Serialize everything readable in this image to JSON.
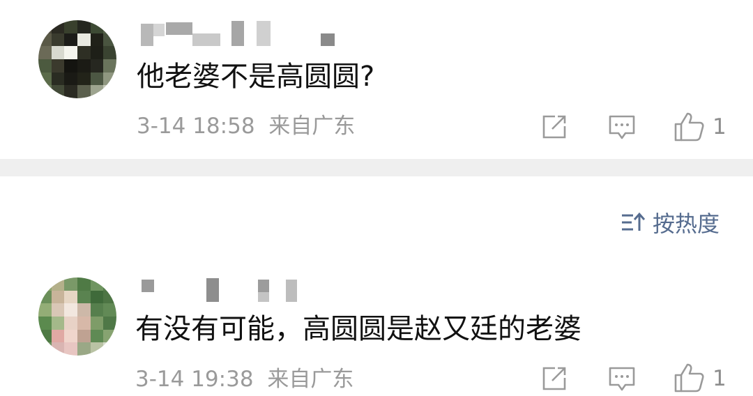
{
  "comments": [
    {
      "text": "他老婆不是高圆圆?",
      "date": "3-14 18:58",
      "location": "来自广东",
      "like_count": "1",
      "icons": [
        "share-icon",
        "reply-icon",
        "like-icon"
      ]
    },
    {
      "text": "有没有可能，高圆圆是赵又廷的老婆",
      "date": "3-14 19:38",
      "location": "来自广东",
      "like_count": "1",
      "icons": [
        "share-icon",
        "reply-icon",
        "like-icon"
      ]
    }
  ],
  "sort": {
    "label": "按热度",
    "icon": "sort-icon"
  },
  "colors": {
    "text": "#111111",
    "meta": "#9a9a9a",
    "sort": "#566c8f",
    "divider": "#efefef"
  }
}
